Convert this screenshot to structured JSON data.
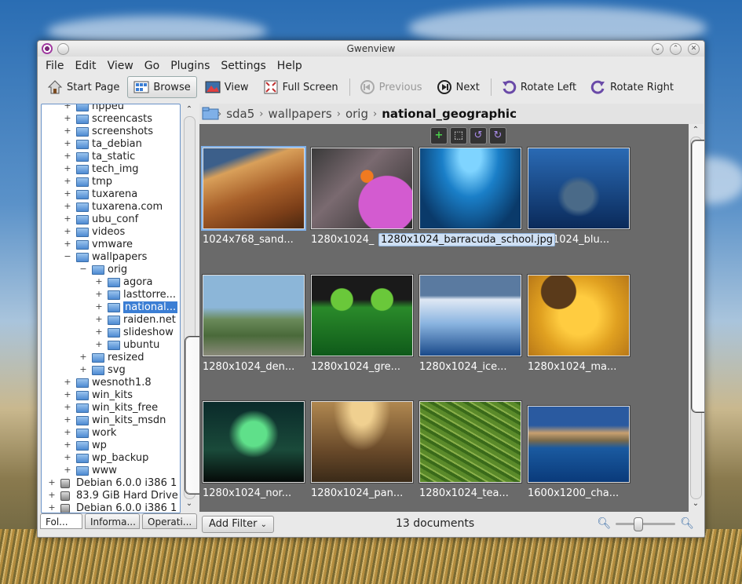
{
  "window": {
    "title": "Gwenview"
  },
  "menu": [
    "File",
    "Edit",
    "View",
    "Go",
    "Plugins",
    "Settings",
    "Help"
  ],
  "toolbar": {
    "start_page": "Start Page",
    "browse": "Browse",
    "view": "View",
    "full_screen": "Full Screen",
    "previous": "Previous",
    "next": "Next",
    "rotate_left": "Rotate Left",
    "rotate_right": "Rotate Right"
  },
  "tree": [
    {
      "label": "nppeu",
      "level": 1
    },
    {
      "label": "screencasts",
      "level": 1
    },
    {
      "label": "screenshots",
      "level": 1
    },
    {
      "label": "ta_debian",
      "level": 1
    },
    {
      "label": "ta_static",
      "level": 1
    },
    {
      "label": "tech_img",
      "level": 1
    },
    {
      "label": "tmp",
      "level": 1
    },
    {
      "label": "tuxarena",
      "level": 1
    },
    {
      "label": "tuxarena.com",
      "level": 1
    },
    {
      "label": "ubu_conf",
      "level": 1
    },
    {
      "label": "videos",
      "level": 1
    },
    {
      "label": "vmware",
      "level": 1
    },
    {
      "label": "wallpapers",
      "level": 1,
      "expanded": true
    },
    {
      "label": "orig",
      "level": 2,
      "expanded": true
    },
    {
      "label": "agora",
      "level": 3
    },
    {
      "label": "lasttorre...",
      "level": 3
    },
    {
      "label": "national...",
      "level": 3,
      "selected": true
    },
    {
      "label": "raiden.net",
      "level": 3
    },
    {
      "label": "slideshow",
      "level": 3
    },
    {
      "label": "ubuntu",
      "level": 3
    },
    {
      "label": "resized",
      "level": 2
    },
    {
      "label": "svg",
      "level": 2
    },
    {
      "label": "wesnoth1.8",
      "level": 1
    },
    {
      "label": "win_kits",
      "level": 1
    },
    {
      "label": "win_kits_free",
      "level": 1
    },
    {
      "label": "win_kits_msdn",
      "level": 1
    },
    {
      "label": "work",
      "level": 1
    },
    {
      "label": "wp",
      "level": 1
    },
    {
      "label": "wp_backup",
      "level": 1
    },
    {
      "label": "www",
      "level": 1
    },
    {
      "label": "Debian 6.0.0 i386 1",
      "level": 0,
      "device": true
    },
    {
      "label": "83.9 GiB Hard Drive",
      "level": 0,
      "device": true
    },
    {
      "label": "Debian 6.0.0 i386 1",
      "level": 0,
      "device": true
    }
  ],
  "tabs": [
    "Fol...",
    "Informa...",
    "Operati..."
  ],
  "breadcrumb": [
    "sda5",
    "wallpapers",
    "orig"
  ],
  "breadcrumb_current": "national_geographic",
  "thumbnails": [
    "1024x768_sand...",
    "1280x1024_",
    "1280x1024_barracuda_school.jpg",
    "1024_blu...",
    "1280x1024_den...",
    "1280x1024_gre...",
    "1280x1024_ice...",
    "1280x1024_ma...",
    "1280x1024_nor...",
    "1280x1024_pan...",
    "1280x1024_tea...",
    "1600x1200_cha..."
  ],
  "tooltip": "1280x1024_barracuda_school.jpg",
  "status": {
    "add_filter": "Add Filter",
    "count": "13 documents"
  },
  "zoom_level": 0.35
}
